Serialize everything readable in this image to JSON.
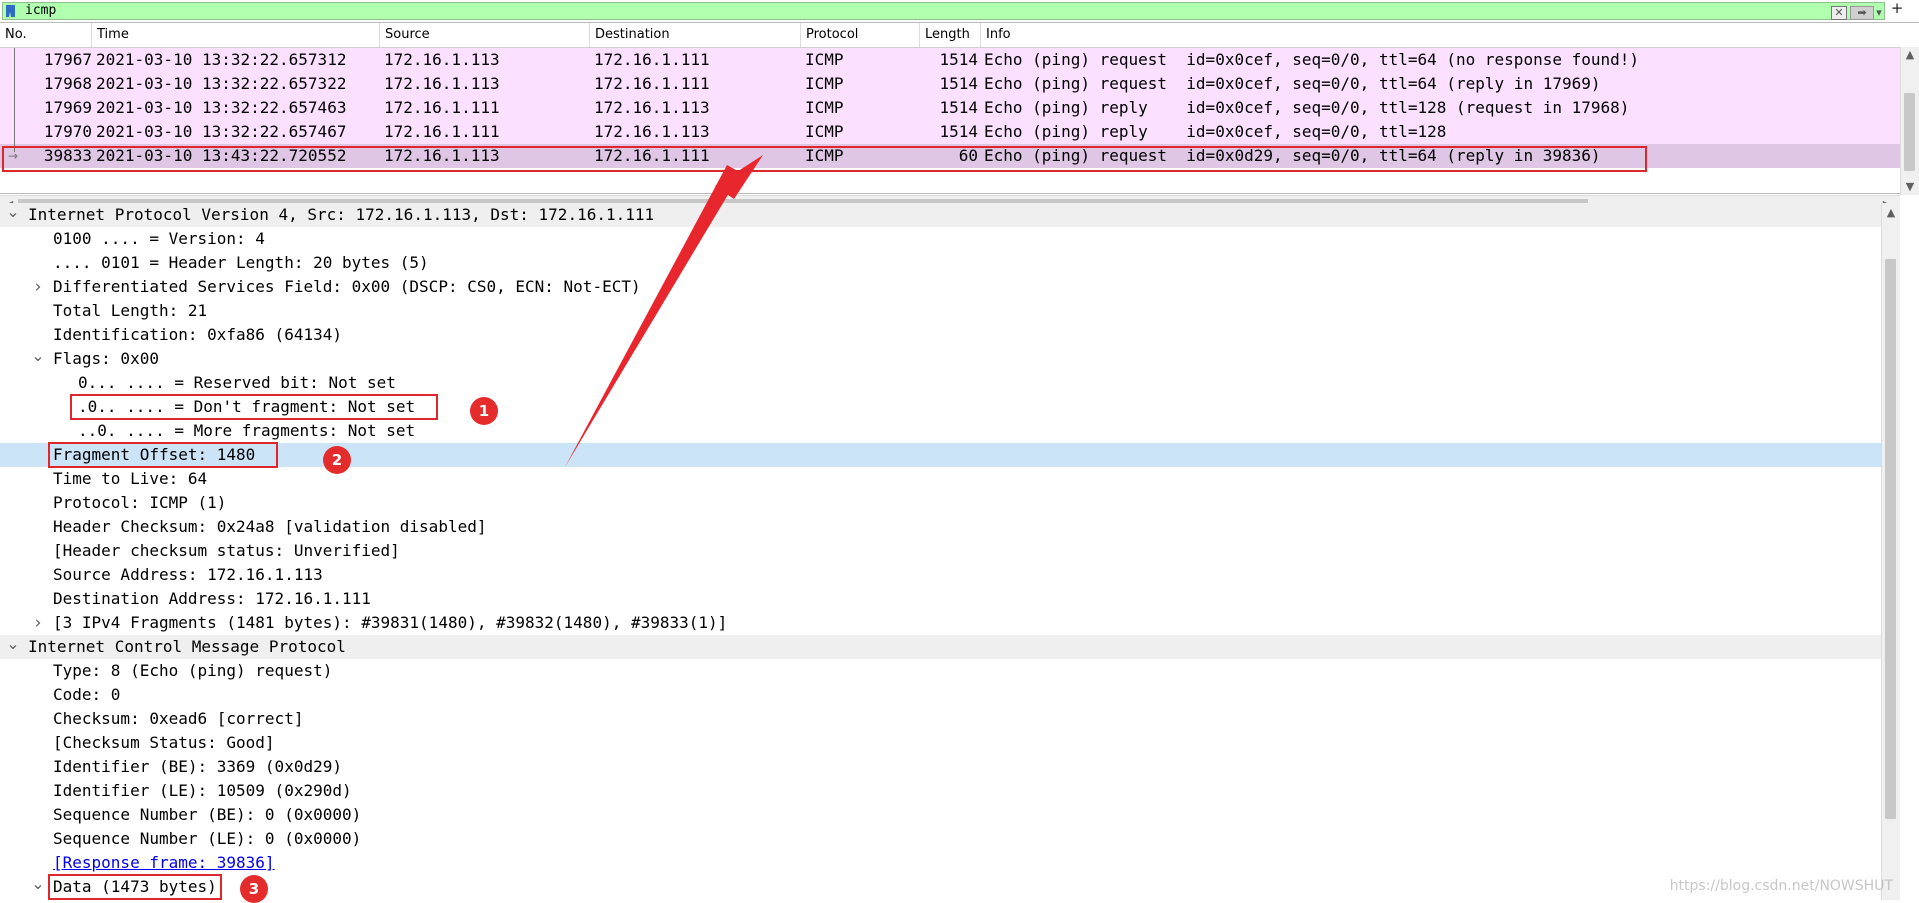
{
  "filter": {
    "text": "icmp"
  },
  "packet_list": {
    "columns": [
      "No.",
      "Time",
      "Source",
      "Destination",
      "Protocol",
      "Length",
      "Info"
    ],
    "rows": [
      {
        "no": "17967",
        "time": "2021-03-10 13:32:22.657312",
        "src": "172.16.1.113",
        "dst": "172.16.1.111",
        "proto": "ICMP",
        "len": "1514",
        "info": "Echo (ping) request  id=0x0cef, seq=0/0, ttl=64 (no response found!)"
      },
      {
        "no": "17968",
        "time": "2021-03-10 13:32:22.657322",
        "src": "172.16.1.113",
        "dst": "172.16.1.111",
        "proto": "ICMP",
        "len": "1514",
        "info": "Echo (ping) request  id=0x0cef, seq=0/0, ttl=64 (reply in 17969)"
      },
      {
        "no": "17969",
        "time": "2021-03-10 13:32:22.657463",
        "src": "172.16.1.111",
        "dst": "172.16.1.113",
        "proto": "ICMP",
        "len": "1514",
        "info": "Echo (ping) reply    id=0x0cef, seq=0/0, ttl=128 (request in 17968)"
      },
      {
        "no": "17970",
        "time": "2021-03-10 13:32:22.657467",
        "src": "172.16.1.111",
        "dst": "172.16.1.113",
        "proto": "ICMP",
        "len": "1514",
        "info": "Echo (ping) reply    id=0x0cef, seq=0/0, ttl=128"
      },
      {
        "no": "39833",
        "time": "2021-03-10 13:43:22.720552",
        "src": "172.16.1.113",
        "dst": "172.16.1.111",
        "proto": "ICMP",
        "len": "60",
        "info": "Echo (ping) request  id=0x0d29, seq=0/0, ttl=64 (reply in 39836)"
      }
    ],
    "colors": {
      "icmp_row": "#fce0ff",
      "selected_row": "#dec6e4"
    }
  },
  "details": {
    "rows": [
      {
        "text": "Internet Protocol Version 4, Src: 172.16.1.113, Dst: 172.16.1.111",
        "twisty": "expanded"
      },
      {
        "text": "0100 .... = Version: 4",
        "twisty": "none"
      },
      {
        "text": ".... 0101 = Header Length: 20 bytes (5)",
        "twisty": "none"
      },
      {
        "text": "Differentiated Services Field: 0x00 (DSCP: CS0, ECN: Not-ECT)",
        "twisty": "collapsed"
      },
      {
        "text": "Total Length: 21",
        "twisty": "none"
      },
      {
        "text": "Identification: 0xfa86 (64134)",
        "twisty": "none"
      },
      {
        "text": "Flags: 0x00",
        "twisty": "expanded"
      },
      {
        "text": "0... .... = Reserved bit: Not set",
        "twisty": "none"
      },
      {
        "text": ".0.. .... = Don't fragment: Not set",
        "twisty": "none"
      },
      {
        "text": "..0. .... = More fragments: Not set",
        "twisty": "none"
      },
      {
        "text": "Fragment Offset: 1480",
        "twisty": "none"
      },
      {
        "text": "Time to Live: 64",
        "twisty": "none"
      },
      {
        "text": "Protocol: ICMP (1)",
        "twisty": "none"
      },
      {
        "text": "Header Checksum: 0x24a8 [validation disabled]",
        "twisty": "none"
      },
      {
        "text": "[Header checksum status: Unverified]",
        "twisty": "none"
      },
      {
        "text": "Source Address: 172.16.1.113",
        "twisty": "none"
      },
      {
        "text": "Destination Address: 172.16.1.111",
        "twisty": "none"
      },
      {
        "text": "[3 IPv4 Fragments (1481 bytes): #39831(1480), #39832(1480), #39833(1)]",
        "twisty": "collapsed"
      },
      {
        "text": "Internet Control Message Protocol",
        "twisty": "expanded"
      },
      {
        "text": "Type: 8 (Echo (ping) request)",
        "twisty": "none"
      },
      {
        "text": "Code: 0",
        "twisty": "none"
      },
      {
        "text": "Checksum: 0xead6 [correct]",
        "twisty": "none"
      },
      {
        "text": "[Checksum Status: Good]",
        "twisty": "none"
      },
      {
        "text": "Identifier (BE): 3369 (0x0d29)",
        "twisty": "none"
      },
      {
        "text": "Identifier (LE): 10509 (0x290d)",
        "twisty": "none"
      },
      {
        "text": "Sequence Number (BE): 0 (0x0000)",
        "twisty": "none"
      },
      {
        "text": "Sequence Number (LE): 0 (0x0000)",
        "twisty": "none"
      },
      {
        "text": "[Response frame: 39836]",
        "twisty": "none"
      },
      {
        "text": "Data (1473 bytes)",
        "twisty": "expanded"
      }
    ]
  },
  "annotations": {
    "badges": [
      "1",
      "2",
      "3"
    ],
    "color": "#e0262d"
  },
  "watermark": "https://blog.csdn.net/NOWSHUT"
}
